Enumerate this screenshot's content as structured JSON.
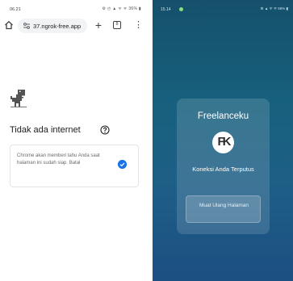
{
  "left": {
    "status_time": "06.21",
    "status_icons": "⚙ ◴ ▲ ᯤ ᯤ 36% ▮",
    "url": "37.ngrok-free.app",
    "tab_count": "8",
    "error_title": "Tidak ada internet",
    "card_text": "Chrome akan memberi tahu Anda saat halaman ini sudah siap. Batal"
  },
  "right": {
    "status_time": "15.14",
    "status_icons": "⚙ ▲ ᯤ ᯤ 59% ▮",
    "app_title": "Freelanceku",
    "logo_text": "FK",
    "message": "Koneksi Anda Terputus",
    "reload_label": "Muat Ulang Halaman"
  },
  "colors": {
    "accent_blue": "#1a73e8",
    "panel_bg": "#17607d"
  }
}
